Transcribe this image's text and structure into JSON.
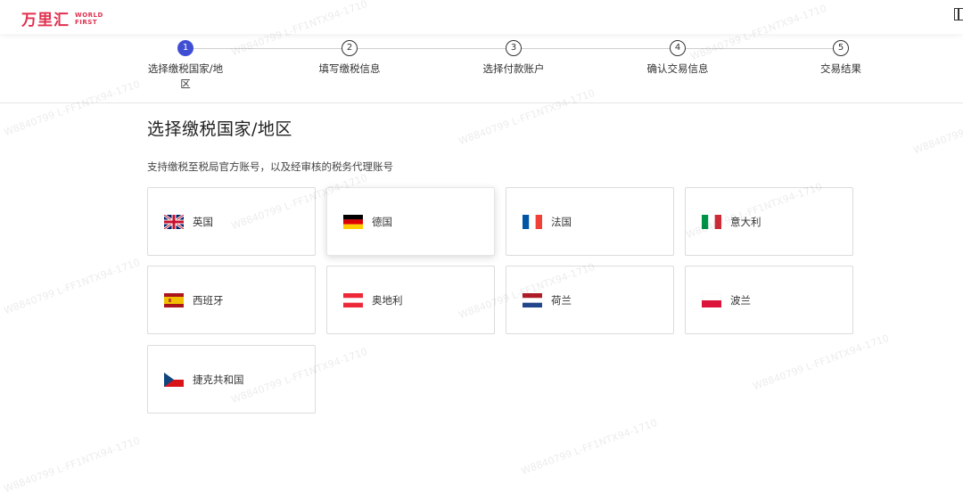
{
  "header": {
    "logo_cn": "万里汇",
    "logo_en_line1": "WORLD",
    "logo_en_line2": "FIRST"
  },
  "steps": [
    {
      "number": "1",
      "label": "选择缴税国家/地区",
      "active": true
    },
    {
      "number": "2",
      "label": "填写缴税信息",
      "active": false
    },
    {
      "number": "3",
      "label": "选择付款账户",
      "active": false
    },
    {
      "number": "4",
      "label": "确认交易信息",
      "active": false
    },
    {
      "number": "5",
      "label": "交易结果",
      "active": false
    }
  ],
  "main": {
    "title": "选择缴税国家/地区",
    "subtitle": "支持缴税至税局官方账号，以及经审核的税务代理账号"
  },
  "countries": [
    {
      "label": "英国",
      "flag": "uk-flag-icon"
    },
    {
      "label": "德国",
      "flag": "germany-flag-icon"
    },
    {
      "label": "法国",
      "flag": "france-flag-icon"
    },
    {
      "label": "意大利",
      "flag": "italy-flag-icon"
    },
    {
      "label": "西班牙",
      "flag": "spain-flag-icon"
    },
    {
      "label": "奥地利",
      "flag": "austria-flag-icon"
    },
    {
      "label": "荷兰",
      "flag": "netherlands-flag-icon"
    },
    {
      "label": "波兰",
      "flag": "poland-flag-icon"
    },
    {
      "label": "捷克共和国",
      "flag": "czech-flag-icon"
    }
  ],
  "watermark_text": "W8840799 L-FF1NTX94-1710",
  "colors": {
    "brand": "#e0304e",
    "step_active": "#3f4ed3"
  }
}
